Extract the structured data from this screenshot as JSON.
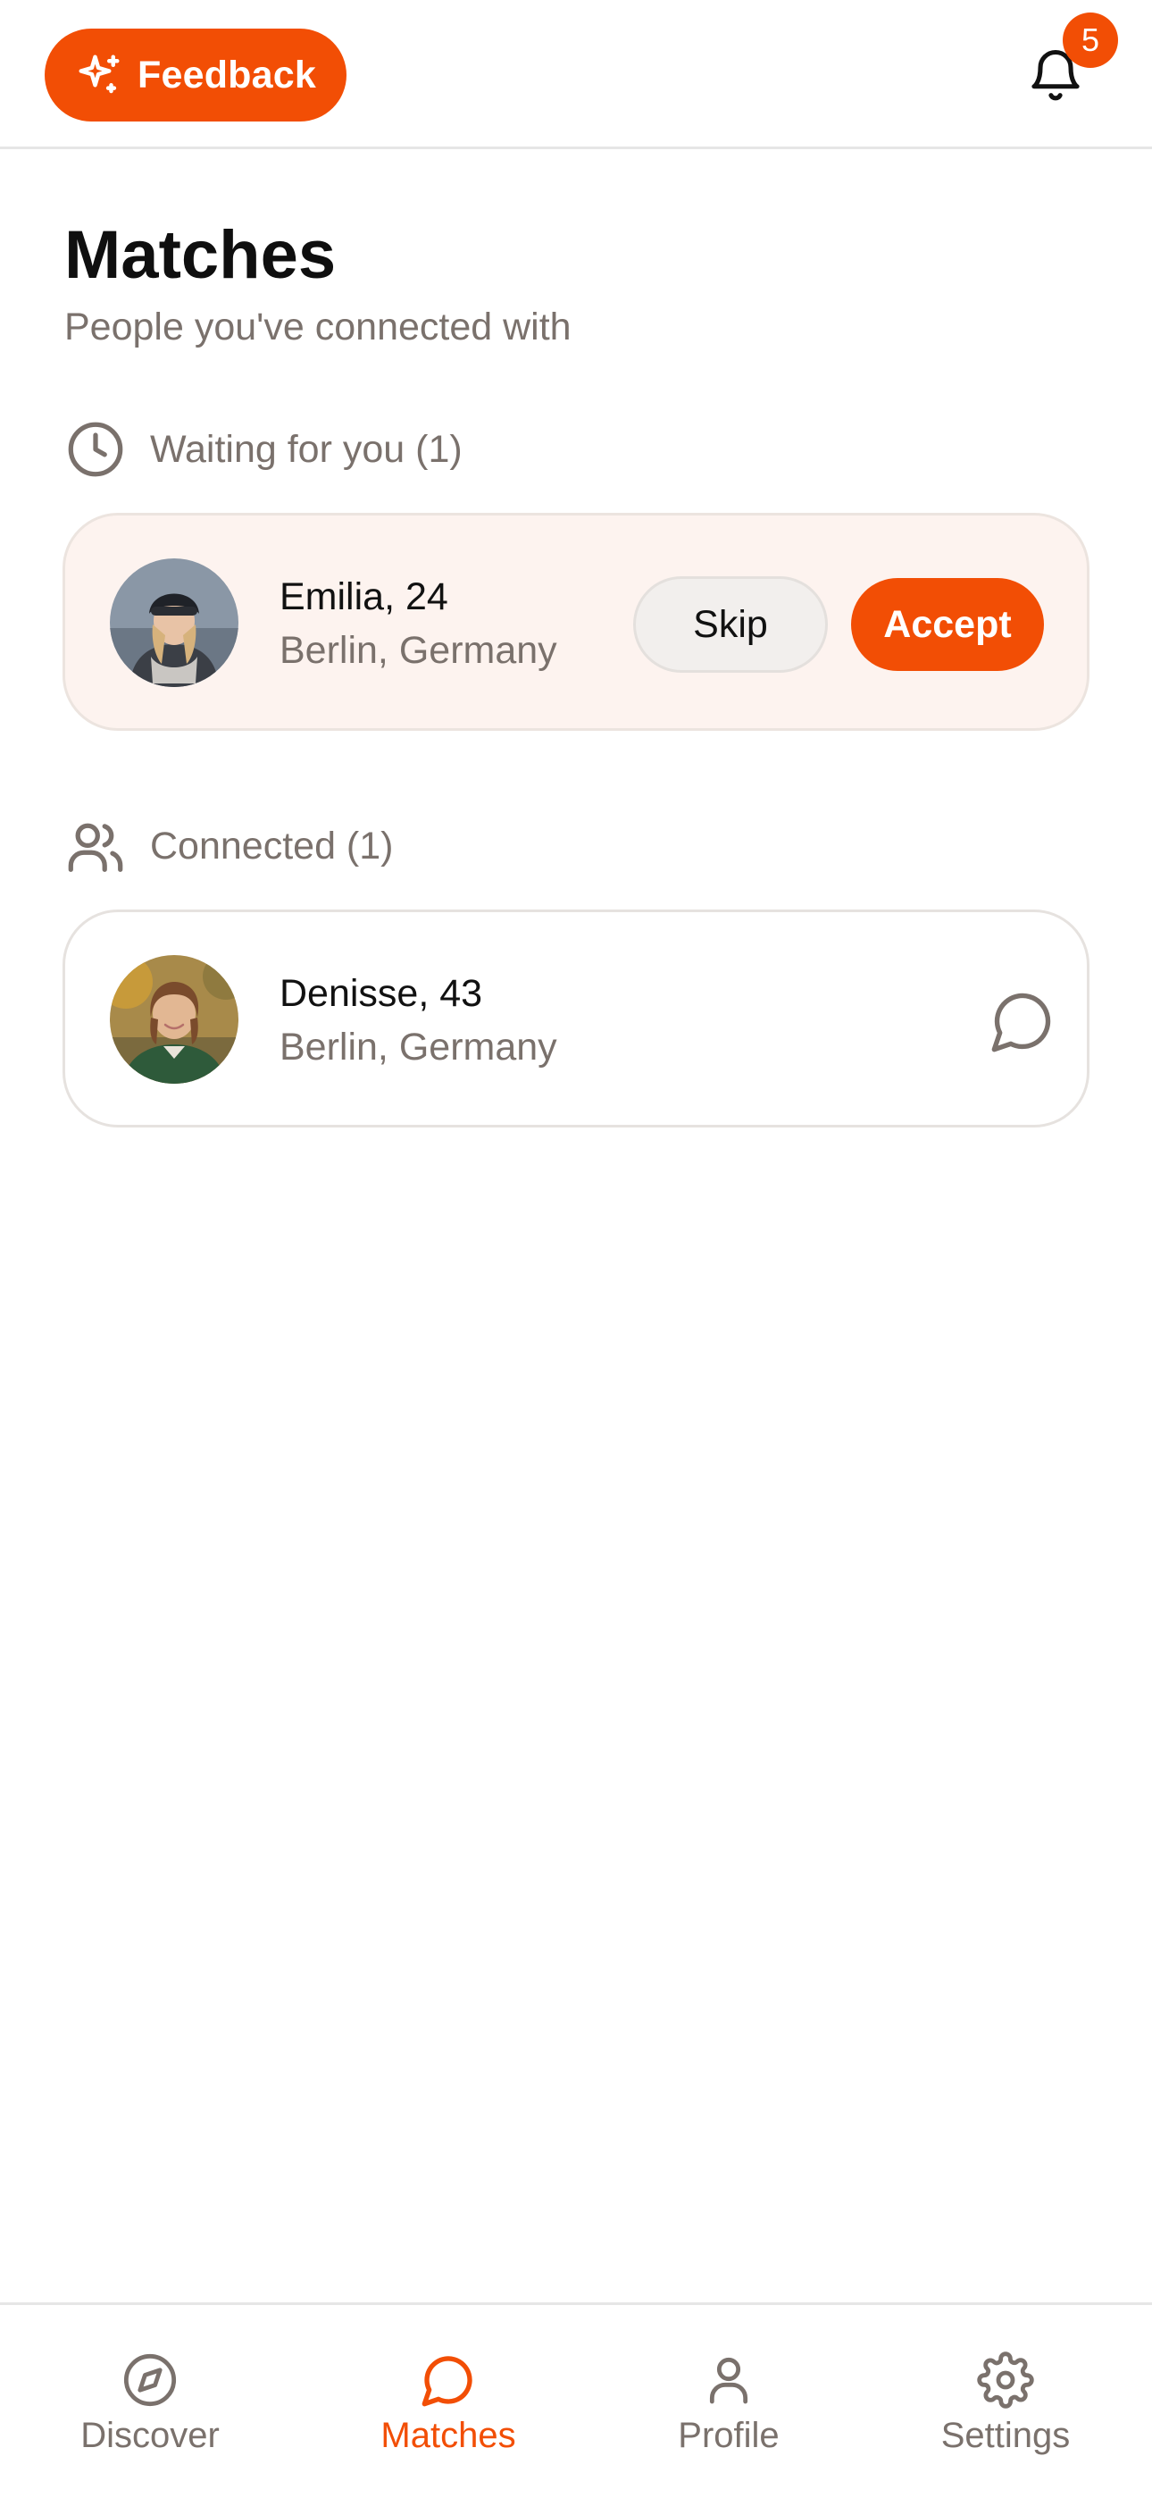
{
  "colors": {
    "accent": "#f24e05",
    "muted_text": "#7a716c",
    "pending_card_bg": "#fdf3ef"
  },
  "topbar": {
    "feedback_label": "Feedback",
    "notification_count": "5"
  },
  "header": {
    "title": "Matches",
    "subtitle": "People you've connected with"
  },
  "waiting": {
    "heading": "Waiting for you (1)",
    "items": [
      {
        "name": "Emilia, 24",
        "location": "Berlin, Germany",
        "skip_label": "Skip",
        "accept_label": "Accept"
      }
    ]
  },
  "connected": {
    "heading": "Connected (1)",
    "items": [
      {
        "name": "Denisse, 43",
        "location": "Berlin, Germany"
      }
    ]
  },
  "bottom_nav": {
    "items": [
      {
        "label": "Discover",
        "icon": "compass-icon",
        "active": false
      },
      {
        "label": "Matches",
        "icon": "chat-bubble-icon",
        "active": true
      },
      {
        "label": "Profile",
        "icon": "person-icon",
        "active": false
      },
      {
        "label": "Settings",
        "icon": "gear-icon",
        "active": false
      }
    ]
  }
}
